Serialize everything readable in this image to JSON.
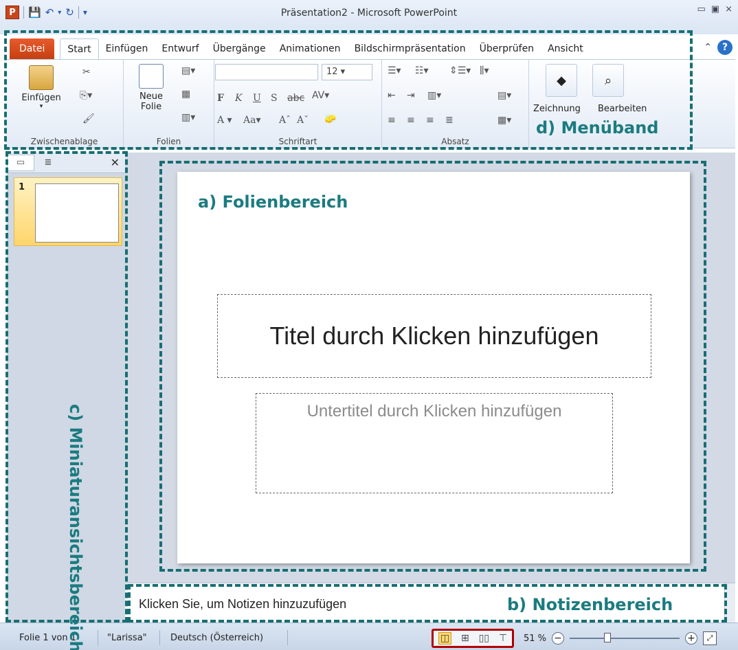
{
  "window": {
    "title": "Präsentation2 - Microsoft PowerPoint",
    "app_icon_letter": "P",
    "controls": [
      "▭",
      "▣",
      "⨯"
    ]
  },
  "tabs": [
    "Datei",
    "Start",
    "Einfügen",
    "Entwurf",
    "Übergänge",
    "Animationen",
    "Bildschirmpräsentation",
    "Überprüfen",
    "Ansicht"
  ],
  "ribbon": {
    "paste_label": "Einfügen",
    "new_slide_label": "Neue\nFolie",
    "font_size": "12",
    "drawing_label": "Zeichnung",
    "edit_label": "Bearbeiten",
    "groups": {
      "clipboard": "Zwischenablage",
      "slides": "Folien",
      "font": "Schriftart",
      "paragraph": "Absatz"
    }
  },
  "annotations": {
    "ribbon": "d) Menüband",
    "slide_area": "a) Folienbereich",
    "thumbnails": "c) Miniaturansichtsbereich",
    "notes": "b) Notizenbereich"
  },
  "thumbnail": {
    "number": "1"
  },
  "slide": {
    "title_placeholder": "Titel durch Klicken hinzufügen",
    "subtitle_placeholder": "Untertitel durch Klicken hinzufügen"
  },
  "notes": {
    "placeholder": "Klicken Sie, um  Notizen hinzuzufügen"
  },
  "statusbar": {
    "slide_info": "Folie 1 von 1",
    "theme": "\"Larissa\"",
    "language": "Deutsch (Österreich)",
    "zoom": "51 %"
  },
  "colors": {
    "annotation": "#176e73",
    "highlight_box": "#b00000",
    "datei_tab": "#d54a19"
  }
}
